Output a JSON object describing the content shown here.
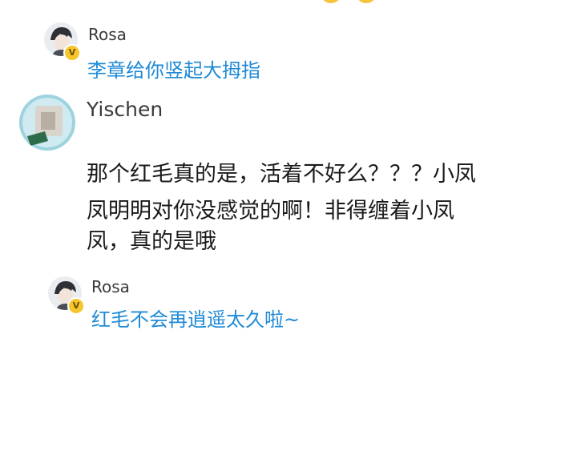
{
  "thread": {
    "reply_1": {
      "username": "Rosa",
      "text": "李章给你竖起大拇指",
      "badge": "V"
    },
    "comment": {
      "username": "Yischen",
      "lines": [
        "那个红毛真的是，活着不好么？？？小凤",
        "凤明明对你没感觉的啊！非得缠着小凤",
        "凤，真的是哦"
      ]
    },
    "reply_2": {
      "username": "Rosa",
      "text": "红毛不会再逍遥太久啦~",
      "badge": "V"
    }
  },
  "colors": {
    "reply_text": "#1f8ad6",
    "badge": "#f7c52c",
    "username": "#3a3a3a",
    "body_text": "#1a1a1a"
  }
}
